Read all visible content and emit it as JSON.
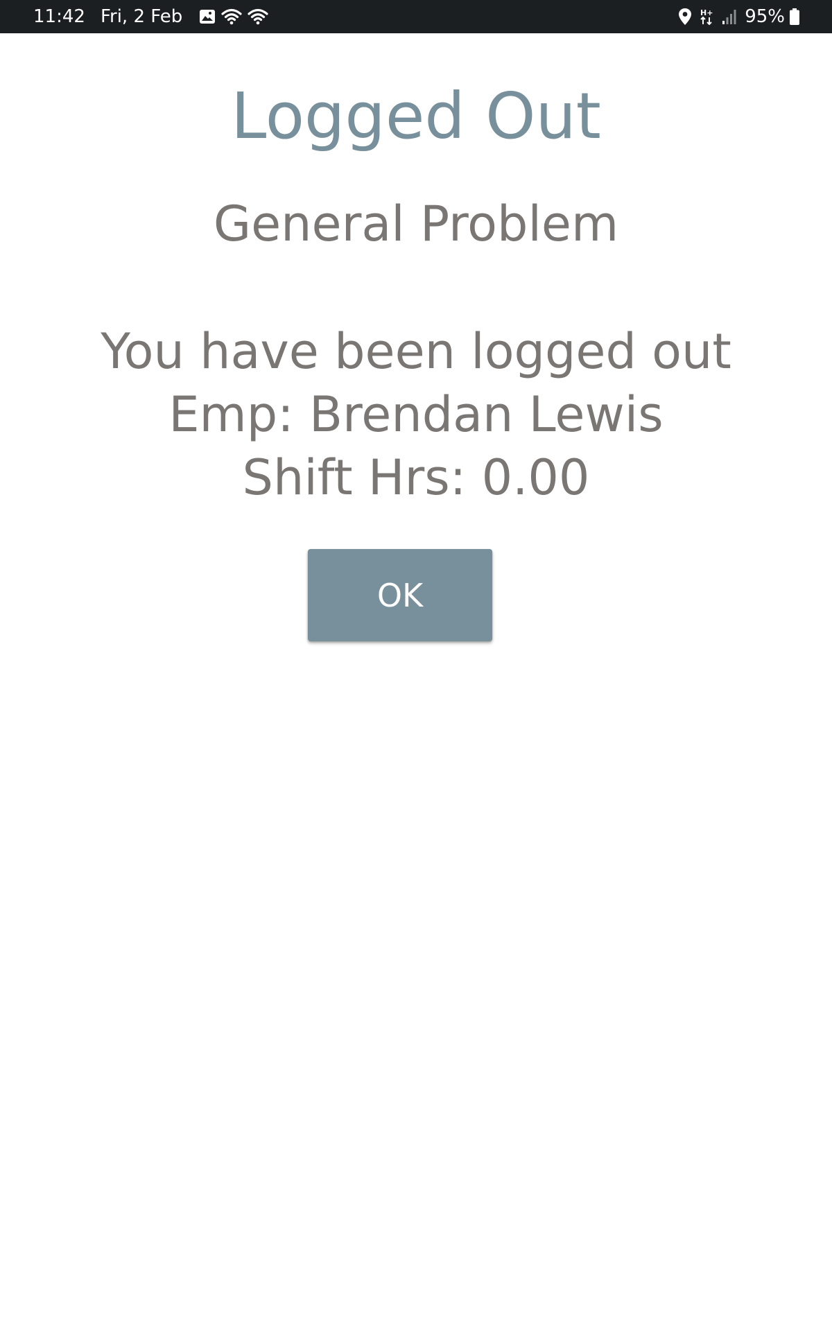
{
  "status_bar": {
    "time": "11:42",
    "date": "Fri, 2 Feb",
    "left_icons": [
      "image-icon",
      "wifi-icon",
      "wifi-icon"
    ],
    "right_icons": [
      "location-icon",
      "data-transfer-icon",
      "signal-icon"
    ],
    "battery_percent": "95%",
    "background_color": "#1c1f22"
  },
  "dialog": {
    "title": "Logged Out",
    "subtitle": "General Problem",
    "message_line1": "You have been logged out",
    "message_line2": "Emp: Brendan Lewis",
    "message_line3": "Shift Hrs: 0.00",
    "ok_label": "OK"
  },
  "colors": {
    "accent": "#78909c",
    "text_gray": "#7a7673",
    "button_text": "#ffffff"
  }
}
